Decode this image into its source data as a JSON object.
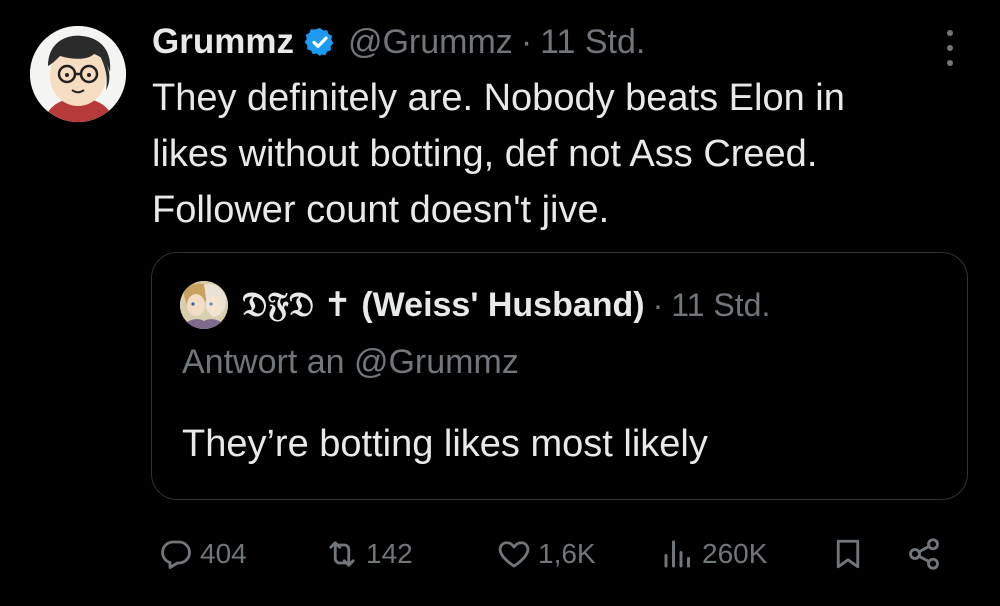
{
  "tweet": {
    "author": {
      "display_name": "Grummz",
      "handle": "@Grummz",
      "verified": true,
      "avatar_icon": "cartoon-glasses-avatar"
    },
    "time": "11 Std.",
    "separator": "·",
    "text_lines": [
      "They definitely are. Nobody beats Elon in",
      "likes without botting, def not Ass Creed.",
      "Follower count doesn't jive."
    ]
  },
  "quote": {
    "author": {
      "display_name": "𝔇𝔉𝔇 ✝ (Weiss' Husband)",
      "avatar_icon": "anime-avatar"
    },
    "time": "11 Std.",
    "separator": "·",
    "reply_to": "Antwort an @Grummz",
    "text": "They’re botting likes most likely"
  },
  "actions": {
    "reply": {
      "icon": "reply-icon",
      "count": "404"
    },
    "repost": {
      "icon": "repost-icon",
      "count": "142"
    },
    "like": {
      "icon": "heart-icon",
      "count": "1,6K"
    },
    "views": {
      "icon": "views-icon",
      "count": "260K"
    },
    "bookmark": {
      "icon": "bookmark-icon"
    },
    "share": {
      "icon": "share-icon"
    }
  },
  "colors": {
    "background": "#000000",
    "text_primary": "#e7e9ea",
    "text_secondary": "#71767b",
    "verified_blue": "#1d9bf0",
    "border": "#2f3336"
  }
}
